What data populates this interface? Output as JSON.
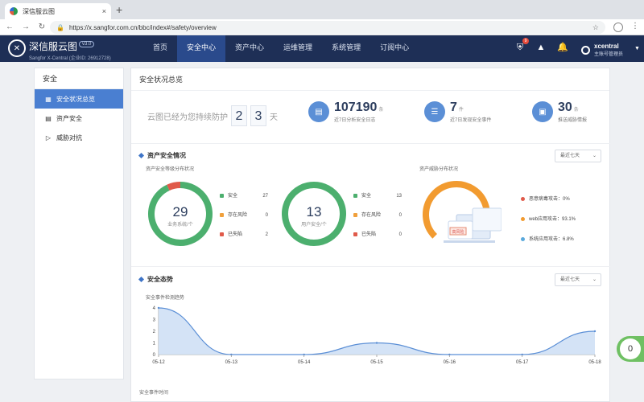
{
  "browser": {
    "tab_title": "深信服云图",
    "tab_close": "×",
    "new_tab": "+",
    "url": "https://x.sangfor.com.cn/bbc/index#/safety/overview"
  },
  "header": {
    "brand_name": "深信服云图",
    "version": "v3.0",
    "brand_sub": "Sangfor X-Central (企业ID: 26912728)",
    "nav": [
      "首页",
      "安全中心",
      "资产中心",
      "运维管理",
      "系统管理",
      "订阅中心"
    ],
    "alert_badge": "9",
    "username": "xcentral",
    "role": "主账号管理员"
  },
  "sidebar": {
    "title": "安全",
    "items": [
      {
        "label": "安全状况总览",
        "icon": "grid-icon"
      },
      {
        "label": "资产安全",
        "icon": "table-icon"
      },
      {
        "label": "威胁对抗",
        "icon": "play-icon"
      }
    ]
  },
  "main": {
    "title": "安全状况总览",
    "protect": {
      "prefix": "云图已经为您持续防护",
      "digits": [
        "2",
        "3"
      ],
      "unit": "天"
    },
    "stats": [
      {
        "value": "107190",
        "unit": "条",
        "desc": "近7日分析安全日志",
        "icon": "document-icon"
      },
      {
        "value": "7",
        "unit": "件",
        "desc": "近7日发现安全事件",
        "icon": "clipboard-icon"
      },
      {
        "value": "30",
        "unit": "条",
        "desc": "推送威胁情报",
        "icon": "calendar-icon"
      }
    ],
    "asset_section": {
      "title": "资产安全情况",
      "select": "最近七天",
      "dist_title": "资产安全等级分布状况",
      "threat_title": "资产威胁分布状况",
      "donut1": {
        "value": "29",
        "label": "业务系统/个",
        "segments": [
          {
            "name": "安全",
            "value": 27
          },
          {
            "name": "存在风险",
            "value": 0
          },
          {
            "name": "已失陷",
            "value": 2
          }
        ]
      },
      "donut2": {
        "value": "13",
        "label": "用户安全/个",
        "segments": [
          {
            "name": "安全",
            "value": 13
          },
          {
            "name": "存在风险",
            "value": 0
          },
          {
            "name": "已失陷",
            "value": 0
          }
        ]
      },
      "donut1_values": [
        "27",
        "0",
        "2"
      ],
      "donut2_values": [
        "13",
        "0",
        "0"
      ],
      "risk_label": "高风险",
      "threat_legend": [
        "恶意病毒攻击：0%",
        "web应用攻击：93.1%",
        "系统应用攻击：6.8%"
      ],
      "threat_gauge": [
        0,
        93.1,
        6.8
      ]
    },
    "trend_section": {
      "title": "安全态势",
      "select": "最近七天",
      "chart_title": "安全事件检测趋势",
      "footer": "安全事件时间"
    }
  },
  "colors": {
    "safe": "#4caf6e",
    "risk": "#f0a03c",
    "lost": "#e05a4a",
    "web": "#f29b30",
    "sys": "#5aa9dc",
    "virus": "#e05a4a",
    "accent": "#4a7fd1"
  },
  "float_badge": "0",
  "chart_data": {
    "type": "area",
    "title": "安全事件检测趋势",
    "categories": [
      "05-12",
      "05-13",
      "05-14",
      "05-15",
      "05-16",
      "05-17",
      "05-18"
    ],
    "values": [
      4,
      0,
      0,
      1,
      0,
      0,
      2
    ],
    "ylim": [
      0,
      4
    ],
    "yticks": [
      "0",
      "1",
      "2",
      "3",
      "4"
    ],
    "grid": false
  }
}
